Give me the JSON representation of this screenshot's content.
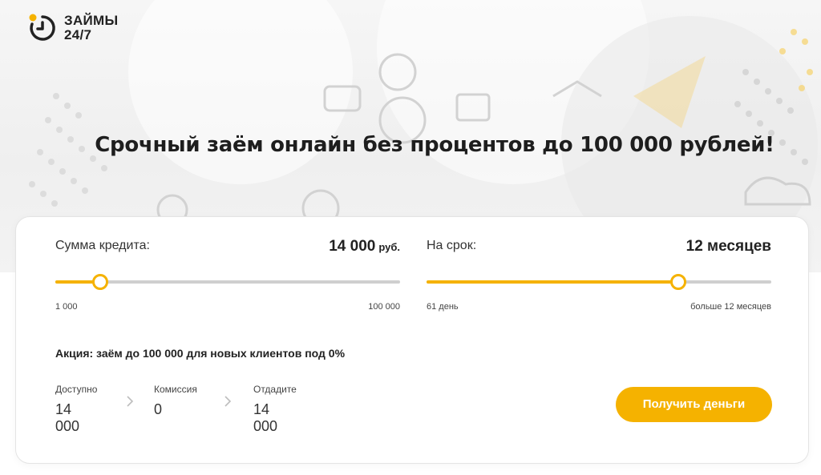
{
  "brand": {
    "name_line1": "ЗАЙМЫ",
    "name_line2": "24/7",
    "accent": "#f5b200"
  },
  "hero": {
    "headline": "Срочный заём онлайн без процентов до 100 000 рублей!"
  },
  "calculator": {
    "amount": {
      "label": "Сумма кредита:",
      "value": "14 000",
      "unit": "руб.",
      "min_label": "1 000",
      "max_label": "100 000",
      "min": 1000,
      "max": 100000,
      "current": 14000
    },
    "term": {
      "label": "На срок:",
      "value": "12 месяцев",
      "min_label": "61 день",
      "max_label": "больше 12 месяцев",
      "fill_fraction": 0.73
    },
    "promo": "Акция: заём до 100 000 для новых клиентов под 0%",
    "summary": {
      "available_label": "Доступно",
      "available_value": "14 000",
      "commission_label": "Комиссия",
      "commission_value": "0",
      "repay_label": "Отдадите",
      "repay_value": "14 000"
    },
    "cta_label": "Получить деньги"
  },
  "icons": {
    "logo": "clock-icon",
    "chevron": "chevron-right-icon"
  }
}
